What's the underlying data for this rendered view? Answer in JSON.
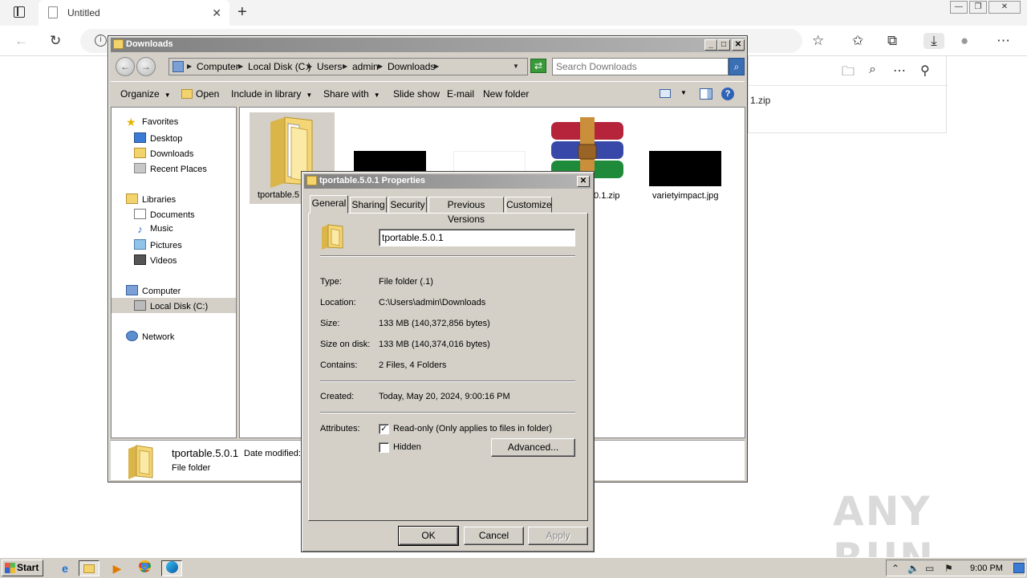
{
  "browser": {
    "tab_title": "Untitled",
    "download_file_partial": "1.zip"
  },
  "explorer": {
    "title": "Downloads",
    "breadcrumb": [
      "Computer",
      "Local Disk (C:)",
      "Users",
      "admin",
      "Downloads"
    ],
    "search_placeholder": "Search Downloads",
    "commands": {
      "organize": "Organize",
      "open": "Open",
      "include_in_library": "Include in library",
      "share_with": "Share with",
      "slide_show": "Slide show",
      "email": "E-mail",
      "new_folder": "New folder"
    },
    "nav": {
      "favorites": "Favorites",
      "desktop": "Desktop",
      "downloads": "Downloads",
      "recent_places": "Recent Places",
      "libraries": "Libraries",
      "documents": "Documents",
      "music": "Music",
      "pictures": "Pictures",
      "videos": "Videos",
      "computer": "Computer",
      "local_disk": "Local Disk (C:)",
      "network": "Network"
    },
    "files": {
      "folder_label": "tportable.5",
      "zip_label": ".0.1.zip",
      "jpg_label": "varietyimpact.jpg"
    },
    "details": {
      "name": "tportable.5.0.1",
      "date_modified_label": "Date modified:",
      "type": "File folder"
    }
  },
  "properties": {
    "title": "tportable.5.0.1 Properties",
    "tabs": [
      "General",
      "Sharing",
      "Security",
      "Previous Versions",
      "Customize"
    ],
    "name_value": "tportable.5.0.1",
    "rows": {
      "type_label": "Type:",
      "type_value": "File folder (.1)",
      "location_label": "Location:",
      "location_value": "C:\\Users\\admin\\Downloads",
      "size_label": "Size:",
      "size_value": "133 MB (140,372,856 bytes)",
      "size_on_disk_label": "Size on disk:",
      "size_on_disk_value": "133 MB (140,374,016 bytes)",
      "contains_label": "Contains:",
      "contains_value": "2 Files, 4 Folders",
      "created_label": "Created:",
      "created_value": "Today, May 20, 2024, 9:00:16 PM",
      "attributes_label": "Attributes:"
    },
    "readonly_label": "Read-only (Only applies to files in folder)",
    "readonly_checked": true,
    "hidden_label": "Hidden",
    "hidden_checked": false,
    "advanced_button": "Advanced...",
    "ok_button": "OK",
    "cancel_button": "Cancel",
    "apply_button": "Apply"
  },
  "taskbar": {
    "start_label": "Start",
    "clock": "9:00 PM"
  },
  "watermark": "ANY RUN"
}
